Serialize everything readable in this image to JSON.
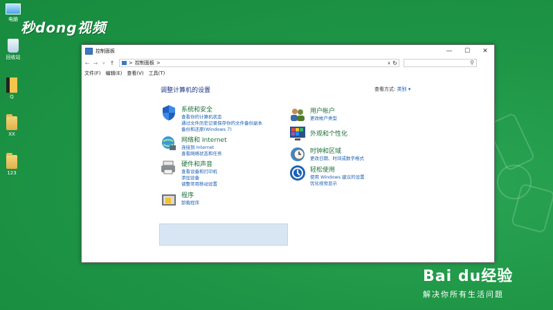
{
  "desktop": {
    "icons": [
      {
        "label": "电脑",
        "icon": "computer-icon"
      },
      {
        "label": "回收站",
        "icon": "recycle-bin-icon"
      },
      {
        "label": "Q",
        "icon": "file-icon"
      },
      {
        "label": "XX",
        "icon": "folder-icon"
      },
      {
        "label": "123",
        "icon": "folder-icon"
      }
    ],
    "brand_top": "秒dong视频",
    "brand_bottom": "Bai du经验",
    "brand_bottom_sub": "解决你所有生活问题"
  },
  "window": {
    "title": "控制面板",
    "controls": [
      "—",
      "☐",
      "✕"
    ],
    "address": {
      "crumb": "控制面板",
      "sep": ">",
      "refresh": "↻",
      "dropdown": "∨"
    },
    "search": {
      "placeholder": "",
      "icon": "search-icon"
    },
    "nav": {
      "back": "←",
      "forward": "→",
      "recent": "∨",
      "up": "↑"
    },
    "menu": [
      "文件(F)",
      "编辑(E)",
      "查看(V)",
      "工具(T)"
    ],
    "heading": "调整计算机的设置",
    "view_by": {
      "label": "查看方式:",
      "value": "类别 ▾"
    },
    "categories_left": [
      {
        "title": "系统和安全",
        "icon": "shield-icon",
        "links": [
          "查看你的计算机状态",
          "通过文件历史记录保存你的文件备份副本",
          "备份和还原(Windows 7)"
        ]
      },
      {
        "title": "网络和 Internet",
        "icon": "network-globe-icon",
        "links": [
          "连接到 Internet",
          "查看网络状态和任务"
        ]
      },
      {
        "title": "硬件和声音",
        "icon": "printer-icon",
        "links": [
          "查看设备和打印机",
          "添加设备",
          "调整常用移动设置"
        ]
      },
      {
        "title": "程序",
        "icon": "programs-icon",
        "links": [
          "卸载程序"
        ]
      }
    ],
    "categories_right": [
      {
        "title": "用户帐户",
        "icon": "users-icon",
        "links": [
          "更改帐户类型"
        ]
      },
      {
        "title": "外观和个性化",
        "icon": "appearance-icon",
        "links": []
      },
      {
        "title": "时钟和区域",
        "icon": "clock-globe-icon",
        "links": [
          "更改日期、时间或数字格式"
        ]
      },
      {
        "title": "轻松使用",
        "icon": "ease-of-access-icon",
        "links": [
          "使用 Windows 建议的设置",
          "优化视觉显示"
        ]
      }
    ]
  }
}
